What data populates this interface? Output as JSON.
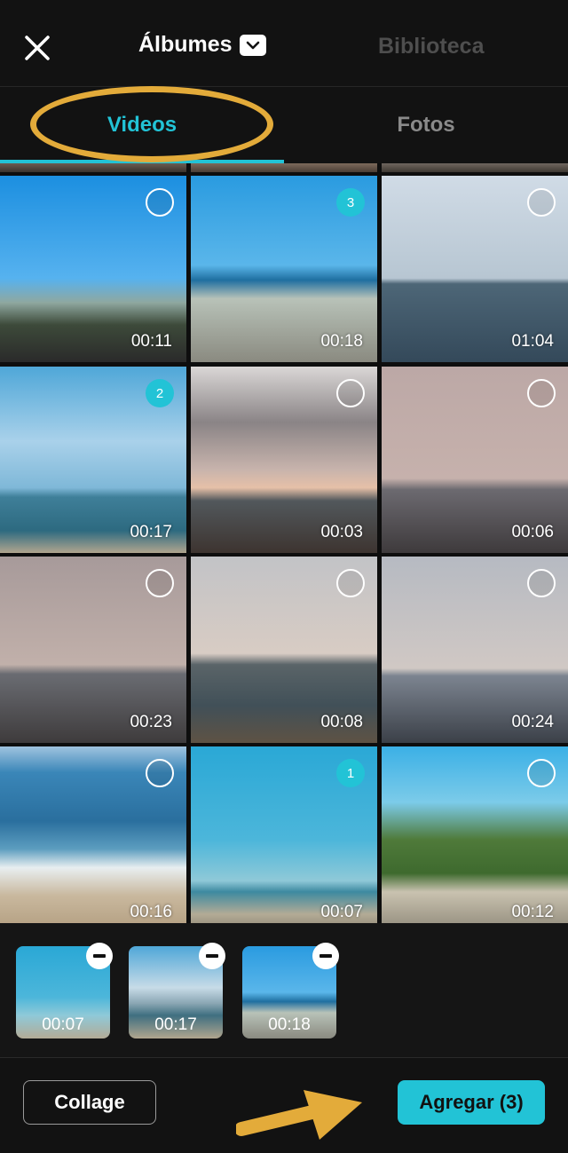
{
  "header": {
    "close_icon": "close-icon",
    "albums_label": "Álbumes",
    "library_label": "Biblioteca"
  },
  "tabs": [
    {
      "label": "Videos",
      "active": true
    },
    {
      "label": "Fotos",
      "active": false
    }
  ],
  "grid": [
    {
      "duration": "00:11",
      "selected": false
    },
    {
      "duration": "00:18",
      "selected": true,
      "order": "3"
    },
    {
      "duration": "01:04",
      "selected": false
    },
    {
      "duration": "00:17",
      "selected": true,
      "order": "2"
    },
    {
      "duration": "00:03",
      "selected": false
    },
    {
      "duration": "00:06",
      "selected": false
    },
    {
      "duration": "00:23",
      "selected": false
    },
    {
      "duration": "00:08",
      "selected": false
    },
    {
      "duration": "00:24",
      "selected": false
    },
    {
      "duration": "00:16",
      "selected": false
    },
    {
      "duration": "00:07",
      "selected": true,
      "order": "1"
    },
    {
      "duration": "00:12",
      "selected": false
    }
  ],
  "tray": [
    {
      "duration": "00:07"
    },
    {
      "duration": "00:17"
    },
    {
      "duration": "00:18"
    }
  ],
  "footer": {
    "collage_label": "Collage",
    "add_label": "Agregar (3)"
  },
  "colors": {
    "accent": "#22c3d6",
    "annotation": "#e3ab3a",
    "background": "#121212"
  }
}
